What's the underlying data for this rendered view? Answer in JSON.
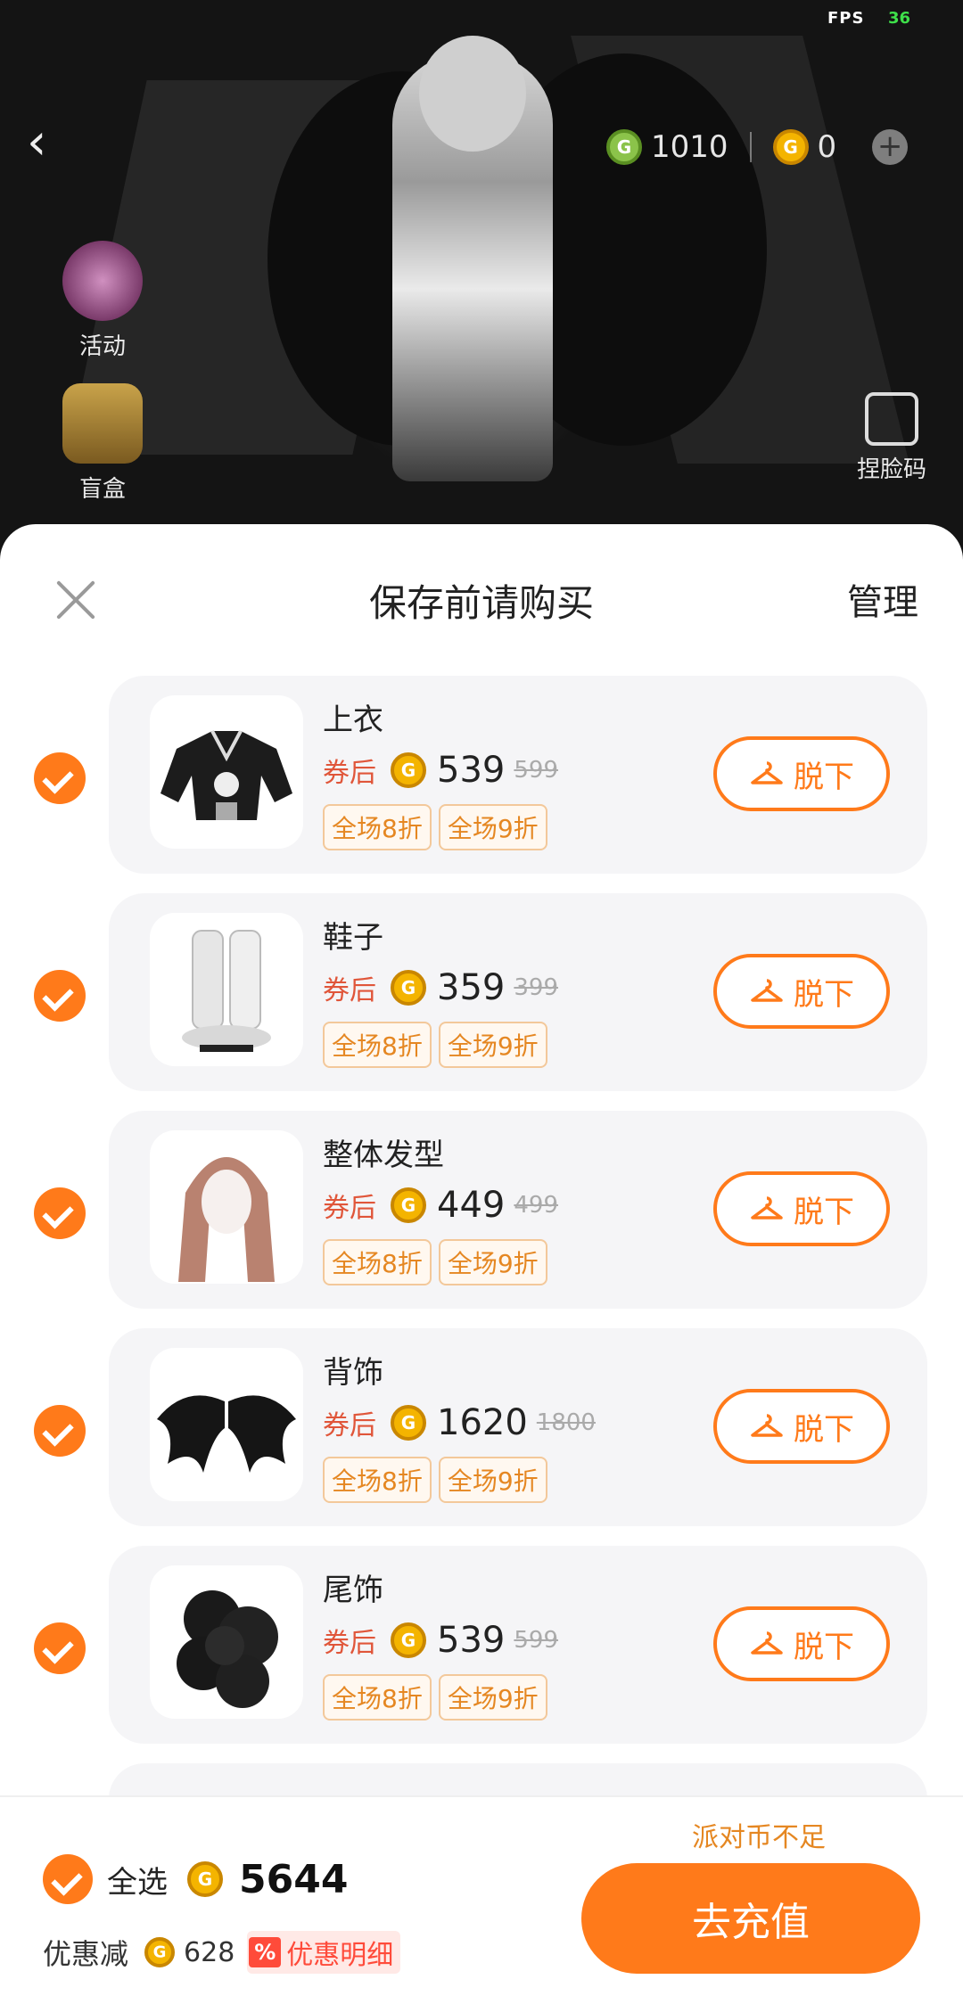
{
  "hud": {
    "fps_label": "FPS",
    "fps_value": "36",
    "green_coins": "1010",
    "gold_coins": "0",
    "plus": "+"
  },
  "side_menu": {
    "activity": "活动",
    "blind_box": "盲盒",
    "pinch_face": "捏脸码"
  },
  "sheet": {
    "title": "保存前请购买",
    "manage": "管理",
    "coupon_after_label": "券后",
    "takeoff_label": "脱下",
    "items": [
      {
        "name": "上衣",
        "price": "539",
        "original": "599",
        "tags": [
          "全场8折",
          "全场9折"
        ],
        "checked": true
      },
      {
        "name": "鞋子",
        "price": "359",
        "original": "399",
        "tags": [
          "全场8折",
          "全场9折"
        ],
        "checked": true
      },
      {
        "name": "整体发型",
        "price": "449",
        "original": "499",
        "tags": [
          "全场8折",
          "全场9折"
        ],
        "checked": true
      },
      {
        "name": "背饰",
        "price": "1620",
        "original": "1800",
        "tags": [
          "全场8折",
          "全场9折"
        ],
        "checked": true
      },
      {
        "name": "尾饰",
        "price": "539",
        "original": "599",
        "tags": [
          "全场8折",
          "全场9折"
        ],
        "checked": true
      }
    ]
  },
  "footer": {
    "insufficient": "派对币不足",
    "select_all": "全选",
    "total": "5644",
    "discount_label": "优惠减",
    "discount_amount": "628",
    "discount_icon": "%",
    "discount_detail": "优惠明细",
    "recharge": "去充值"
  },
  "colors": {
    "accent": "#ff7a1a",
    "coupon_red": "#e0563a",
    "tag_orange": "#e58722"
  }
}
